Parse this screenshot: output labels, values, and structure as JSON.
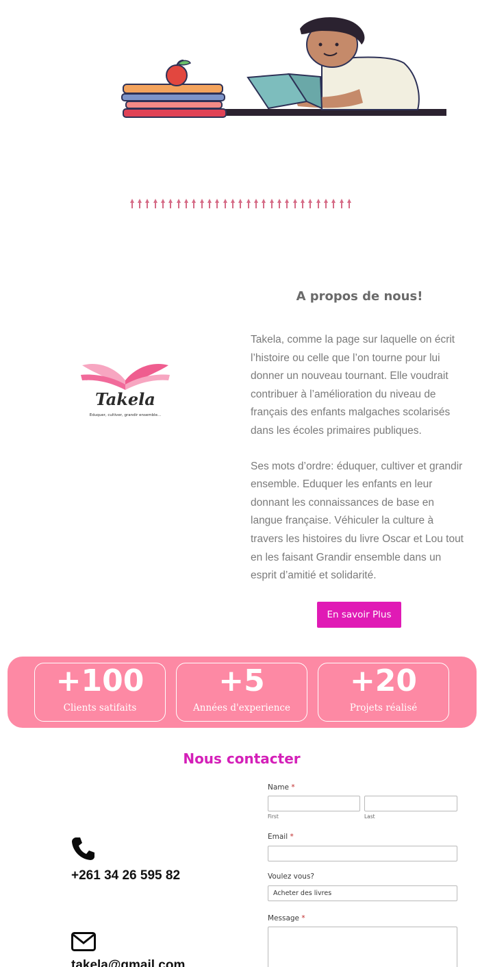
{
  "hero": {
    "image": "student-reading-book-illustration"
  },
  "divider": {
    "image": "decorative-tree-row"
  },
  "about": {
    "title": "A propos de nous!",
    "paragraph1": "Takela, comme la page sur laquelle on écrit l’histoire ou celle que l’on tourne pour lui donner un nouveau tournant. Elle voudrait contribuer à l’amélioration du niveau de français des enfants malgaches scolarisés dans les écoles primaires publiques.",
    "paragraph2": "Ses mots d’ordre: éduquer, cultiver et grandir ensemble. Eduquer les enfants en leur donnant les connaissances de base en langue française. Véhiculer la culture à travers les histoires du livre Oscar et Lou tout en les faisant Grandir ensemble dans un esprit d’amitié et solidarité.",
    "button_label": "En savoir Plus"
  },
  "logo": {
    "name": "Takela",
    "tagline": "Eduquer, cultiver, grandir ensemble..."
  },
  "stats": [
    {
      "value": "+100",
      "label": "Clients satifaits"
    },
    {
      "value": "+5",
      "label": "Années d'experience"
    },
    {
      "value": "+20",
      "label": "Projets réalisé"
    }
  ],
  "contact": {
    "title": "Nous contacter",
    "phone": "+261 34 26 595 82",
    "email_partial": "takela@gmail.com",
    "phone_icon": "phone-icon",
    "mail_icon": "envelope-icon"
  },
  "form": {
    "name_label": "Name",
    "required_mark": "*",
    "first_sublabel": "First",
    "last_sublabel": "Last",
    "email_label": "Email",
    "choice_label": "Voulez vous?",
    "choice_value": "Acheter des livres",
    "message_label": "Message"
  },
  "colors": {
    "accent": "#e01ab5",
    "stats_bg": "#fd89a4",
    "contact_title": "#d41fb8"
  }
}
